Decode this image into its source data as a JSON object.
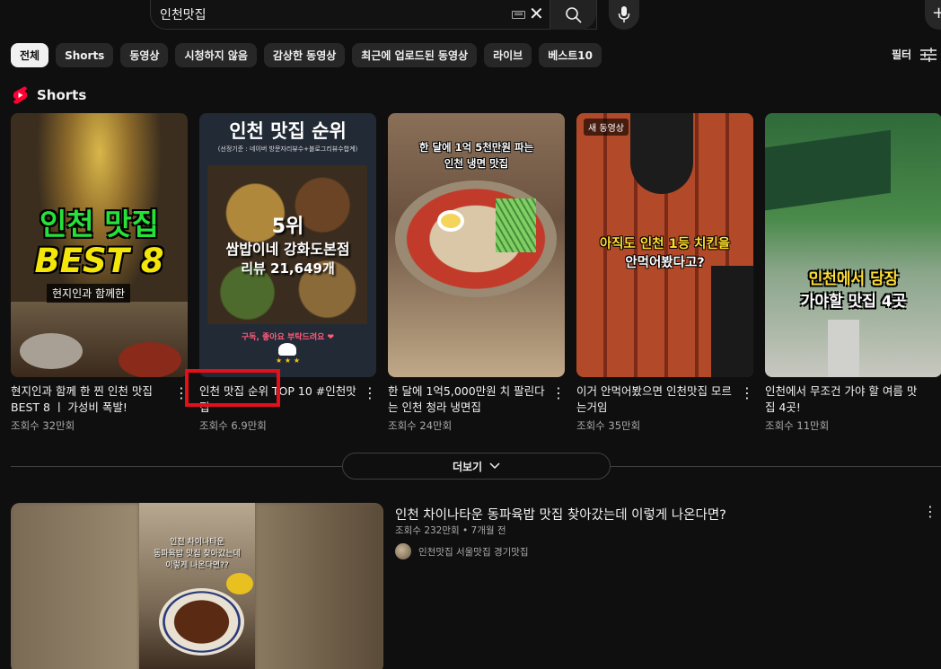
{
  "search": {
    "query": "인천맛집"
  },
  "chips": [
    "전체",
    "Shorts",
    "동영상",
    "시청하지 않음",
    "감상한 동영상",
    "최근에 업로드된 동영상",
    "라이브",
    "베스트10"
  ],
  "filter_label": "필터",
  "shorts_section": {
    "title": "Shorts"
  },
  "shorts": [
    {
      "title": "현지인과 함께 한 찐 인천 맛집 BEST 8 ㅣ 가성비 폭발!",
      "views": "조회수 32만회",
      "overlay": {
        "line1": "인천 맛집",
        "line2": "BEST 8",
        "line3": "현지인과 함께한"
      }
    },
    {
      "title": "인천 맛집 순위 TOP 10 #인천맛집",
      "views": "조회수 6.9만회",
      "overlay": {
        "line1": "인천 맛집 순위",
        "line2": "(선정기준 : 네이버 방문자리뷰수+블로그리뷰수합계)",
        "line3": "5위",
        "line4": "쌈밥이네 강화도본점",
        "line5": "리뷰 21,649개",
        "line6": "구독, 좋아요 부탁드려요 ❤"
      }
    },
    {
      "title": "한 달에 1억5,000만원 치 팔린다는 인천 청라 냉면집",
      "views": "조회수 24만회",
      "overlay": {
        "line1": "한 달에 1억 5천만원 파는",
        "line2": "인천 냉면 맛집"
      }
    },
    {
      "title": "이거 안먹어봤으면 인천맛집 모르는거임",
      "views": "조회수 35만회",
      "overlay": {
        "badge": "새 동영상",
        "line1": "아직도 인천 1등 치킨을",
        "line2": "안먹어봤다고?"
      }
    },
    {
      "title": "인천에서 무조건 가야 할 여름 맛집 4곳!",
      "views": "조회수 11만회",
      "overlay": {
        "line1": "인천에서 당장",
        "line2": "가야할 맛집 4곳"
      }
    }
  ],
  "more_label": "더보기",
  "video": {
    "title": "인천 차이나타운 동파육밥 맛집 찾아갔는데 이렇게 나온다면?",
    "meta": "조회수 232만회 • 7개월 전",
    "channel": "인천맛집 서울맛집 경기맛집",
    "overlay": {
      "line1": "인천 차이나타운",
      "line2": "동파육밥 맛집 찾아갔는데",
      "line3": "이렇게 나온다면??"
    }
  }
}
